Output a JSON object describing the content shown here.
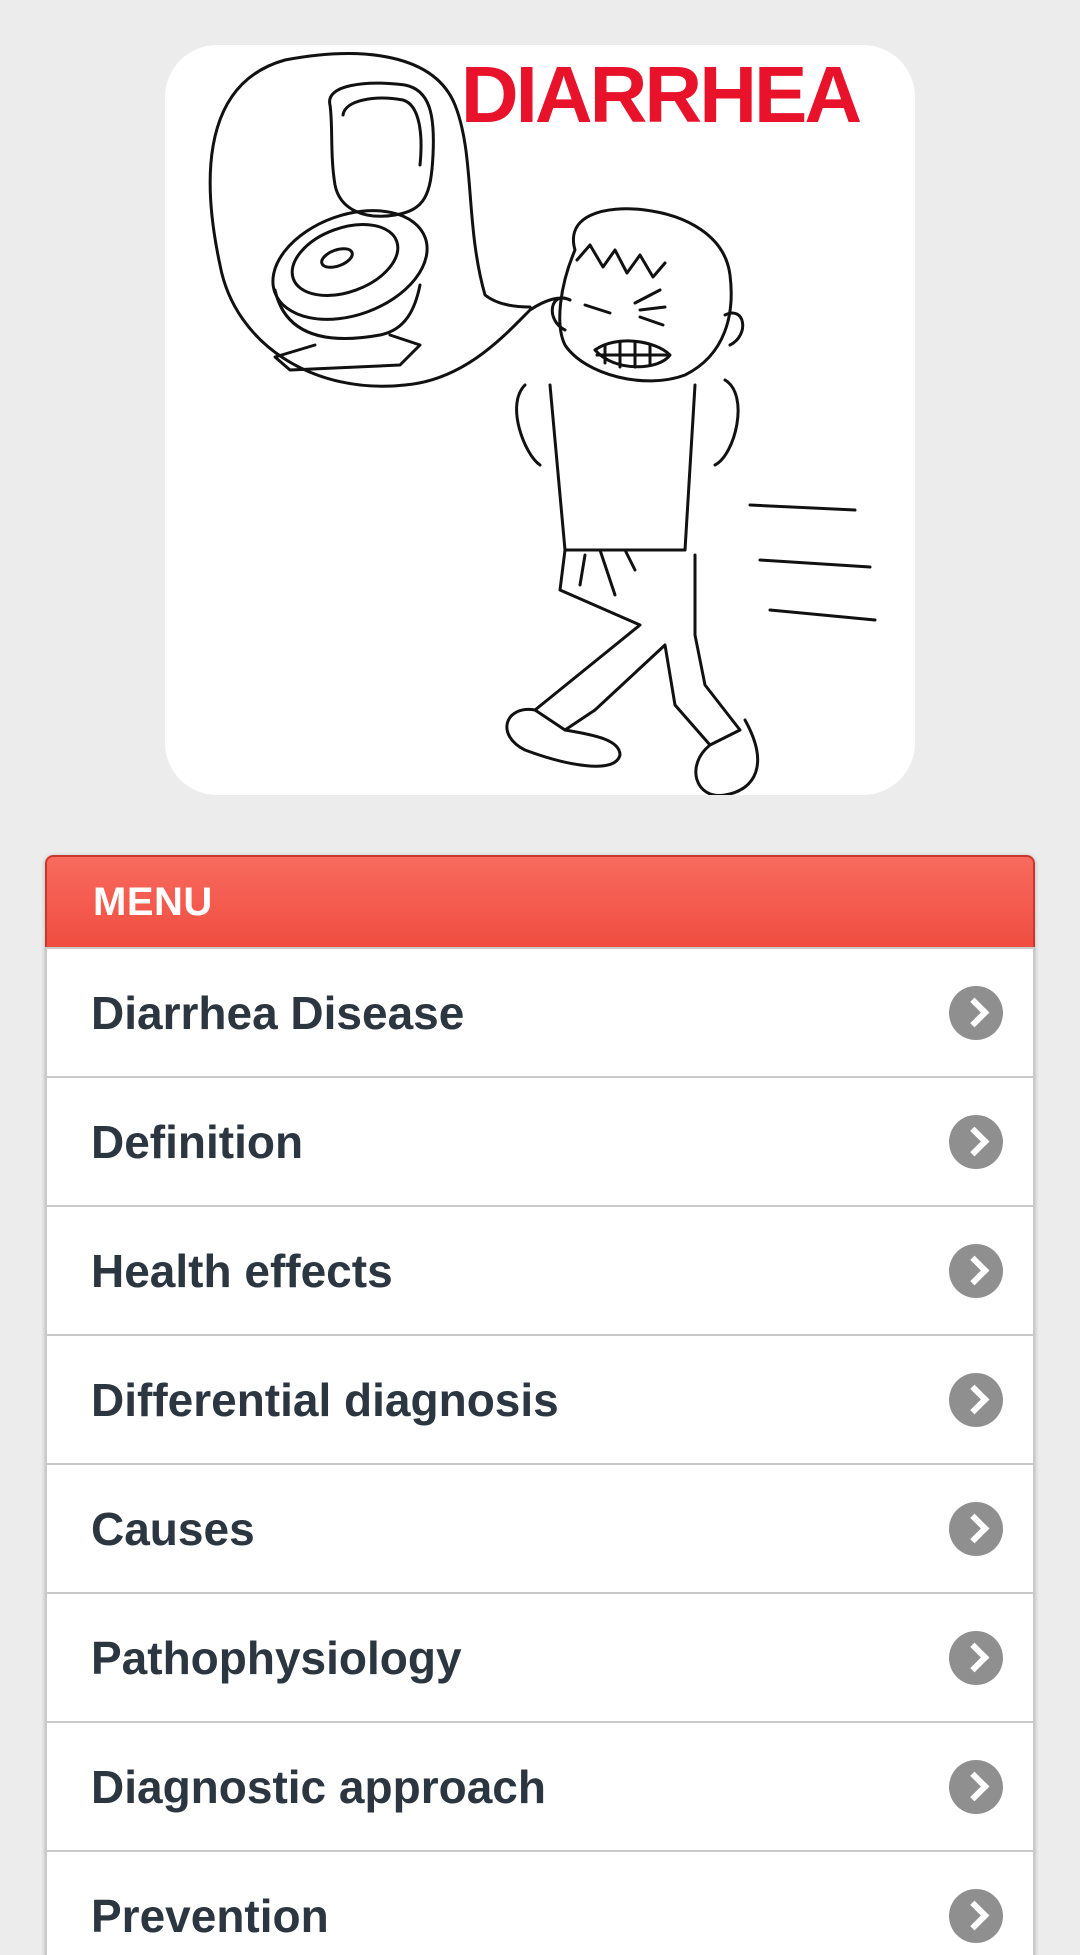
{
  "hero": {
    "title": "DIARRHEA",
    "illustration": "boy-running-to-toilet-illustration",
    "title_color": "#e8132b"
  },
  "menu": {
    "header": "MENU",
    "header_color": "#f25a4e",
    "items": [
      {
        "label": "Diarrhea Disease",
        "icon": "chevron-right-icon"
      },
      {
        "label": "Definition",
        "icon": "chevron-right-icon"
      },
      {
        "label": "Health effects",
        "icon": "chevron-right-icon"
      },
      {
        "label": "Differential diagnosis",
        "icon": "chevron-right-icon"
      },
      {
        "label": "Causes",
        "icon": "chevron-right-icon"
      },
      {
        "label": "Pathophysiology",
        "icon": "chevron-right-icon"
      },
      {
        "label": "Diagnostic approach",
        "icon": "chevron-right-icon"
      },
      {
        "label": "Prevention",
        "icon": "chevron-right-icon"
      }
    ]
  }
}
